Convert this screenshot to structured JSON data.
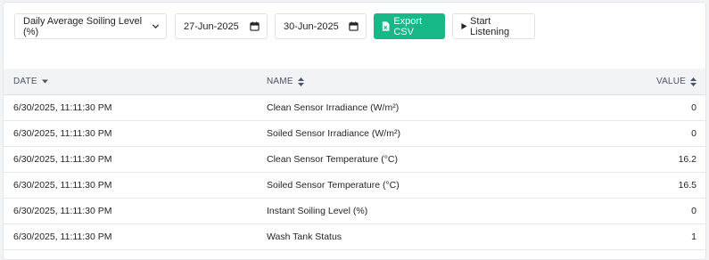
{
  "toolbar": {
    "metric_select": "Daily Average Soiling Level (%)",
    "start_date": "27-Jun-2025",
    "end_date": "30-Jun-2025",
    "export_label": "Export CSV",
    "listen_label": "Start Listening"
  },
  "table": {
    "headers": {
      "date": "DATE",
      "name": "NAME",
      "value": "VALUE"
    },
    "rows": [
      {
        "date": "6/30/2025, 11:11:30 PM",
        "name": "Clean Sensor Irradiance (W/m²)",
        "value": "0"
      },
      {
        "date": "6/30/2025, 11:11:30 PM",
        "name": "Soiled Sensor Irradiance (W/m²)",
        "value": "0"
      },
      {
        "date": "6/30/2025, 11:11:30 PM",
        "name": "Clean Sensor Temperature (°C)",
        "value": "16.2"
      },
      {
        "date": "6/30/2025, 11:11:30 PM",
        "name": "Soiled Sensor Temperature (°C)",
        "value": "16.5"
      },
      {
        "date": "6/30/2025, 11:11:30 PM",
        "name": "Instant Soiling Level (%)",
        "value": "0"
      },
      {
        "date": "6/30/2025, 11:11:30 PM",
        "name": "Wash Tank Status",
        "value": "1"
      }
    ]
  },
  "colors": {
    "accent": "#15b886",
    "header_bg": "#f1f3f5"
  },
  "icons": [
    "chevron-down-icon",
    "calendar-icon",
    "file-excel-icon",
    "play-icon",
    "sort-desc-icon",
    "sort-icon"
  ]
}
